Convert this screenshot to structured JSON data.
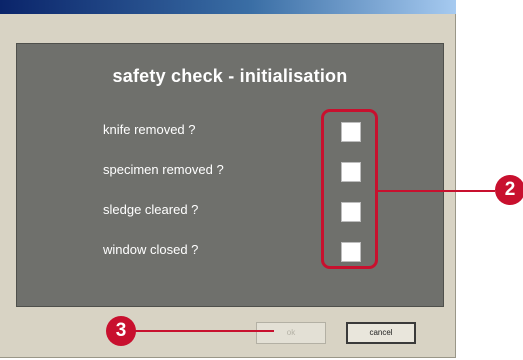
{
  "dialog": {
    "title": "safety check - initialisation",
    "items": [
      {
        "label": "knife removed ?",
        "checked": false
      },
      {
        "label": "specimen removed ?",
        "checked": false
      },
      {
        "label": "sledge cleared ?",
        "checked": false
      },
      {
        "label": "window closed ?",
        "checked": false
      }
    ],
    "buttons": {
      "ok": "ok",
      "cancel": "cancel"
    }
  },
  "callouts": {
    "checkboxes": "2",
    "ok_button": "3"
  },
  "colors": {
    "callout": "#c8102e",
    "panel": "#6f706c",
    "dialog": "#d8d3c4"
  }
}
